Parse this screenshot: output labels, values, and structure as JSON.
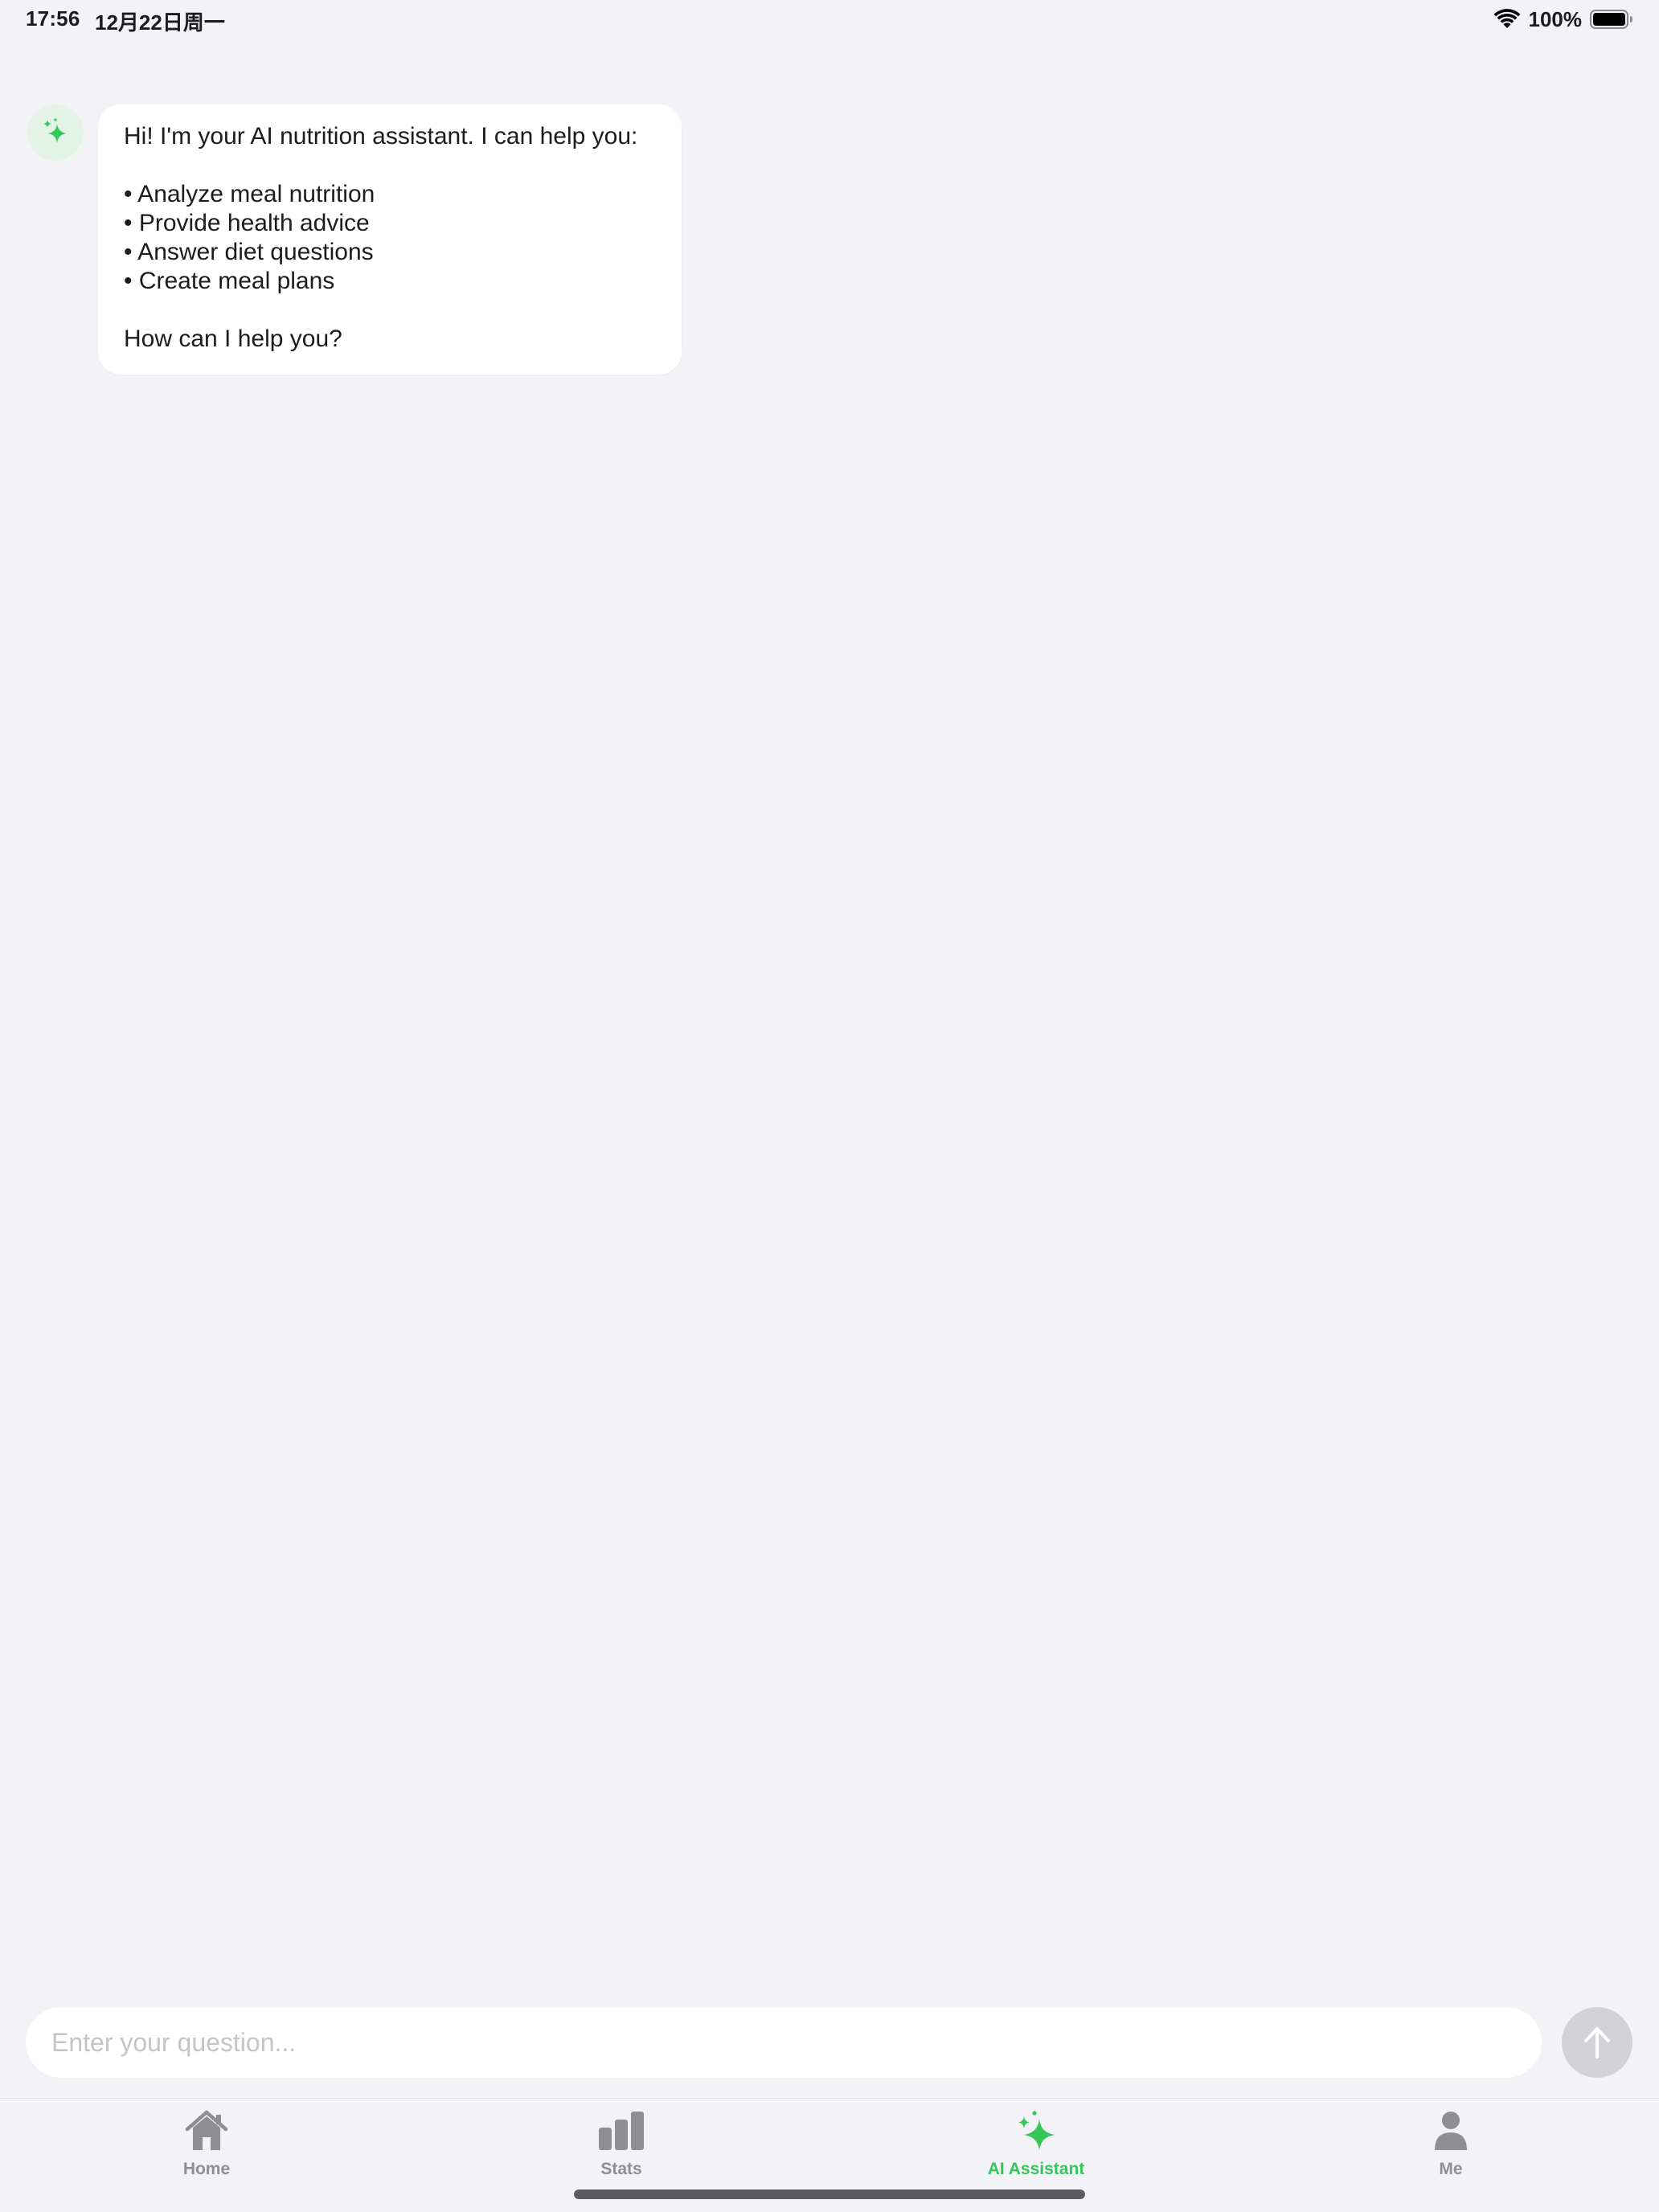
{
  "status_bar": {
    "time": "17:56",
    "date": "12月22日周一",
    "battery_percent": "100%",
    "icons": [
      "wifi-icon",
      "battery-icon"
    ]
  },
  "chat": {
    "assistant_avatar_icon": "sparkle-icon",
    "message": {
      "intro": "Hi! I'm your AI nutrition assistant. I can help you:",
      "bullets": [
        "• Analyze meal nutrition",
        "• Provide health advice",
        "• Answer diet questions",
        "• Create meal plans"
      ],
      "closing": "How can I help you?"
    }
  },
  "input": {
    "placeholder": "Enter your question...",
    "send_icon": "arrow-up-icon"
  },
  "tab_bar": {
    "tabs": [
      {
        "label": "Home",
        "icon": "house-icon",
        "active": false
      },
      {
        "label": "Stats",
        "icon": "bar-chart-icon",
        "active": false
      },
      {
        "label": "AI Assistant",
        "icon": "sparkle-icon",
        "active": true
      },
      {
        "label": "Me",
        "icon": "person-icon",
        "active": false
      }
    ]
  },
  "colors": {
    "accent": "#34c759",
    "background": "#f2f2f7",
    "inactive": "#8e8e93"
  }
}
